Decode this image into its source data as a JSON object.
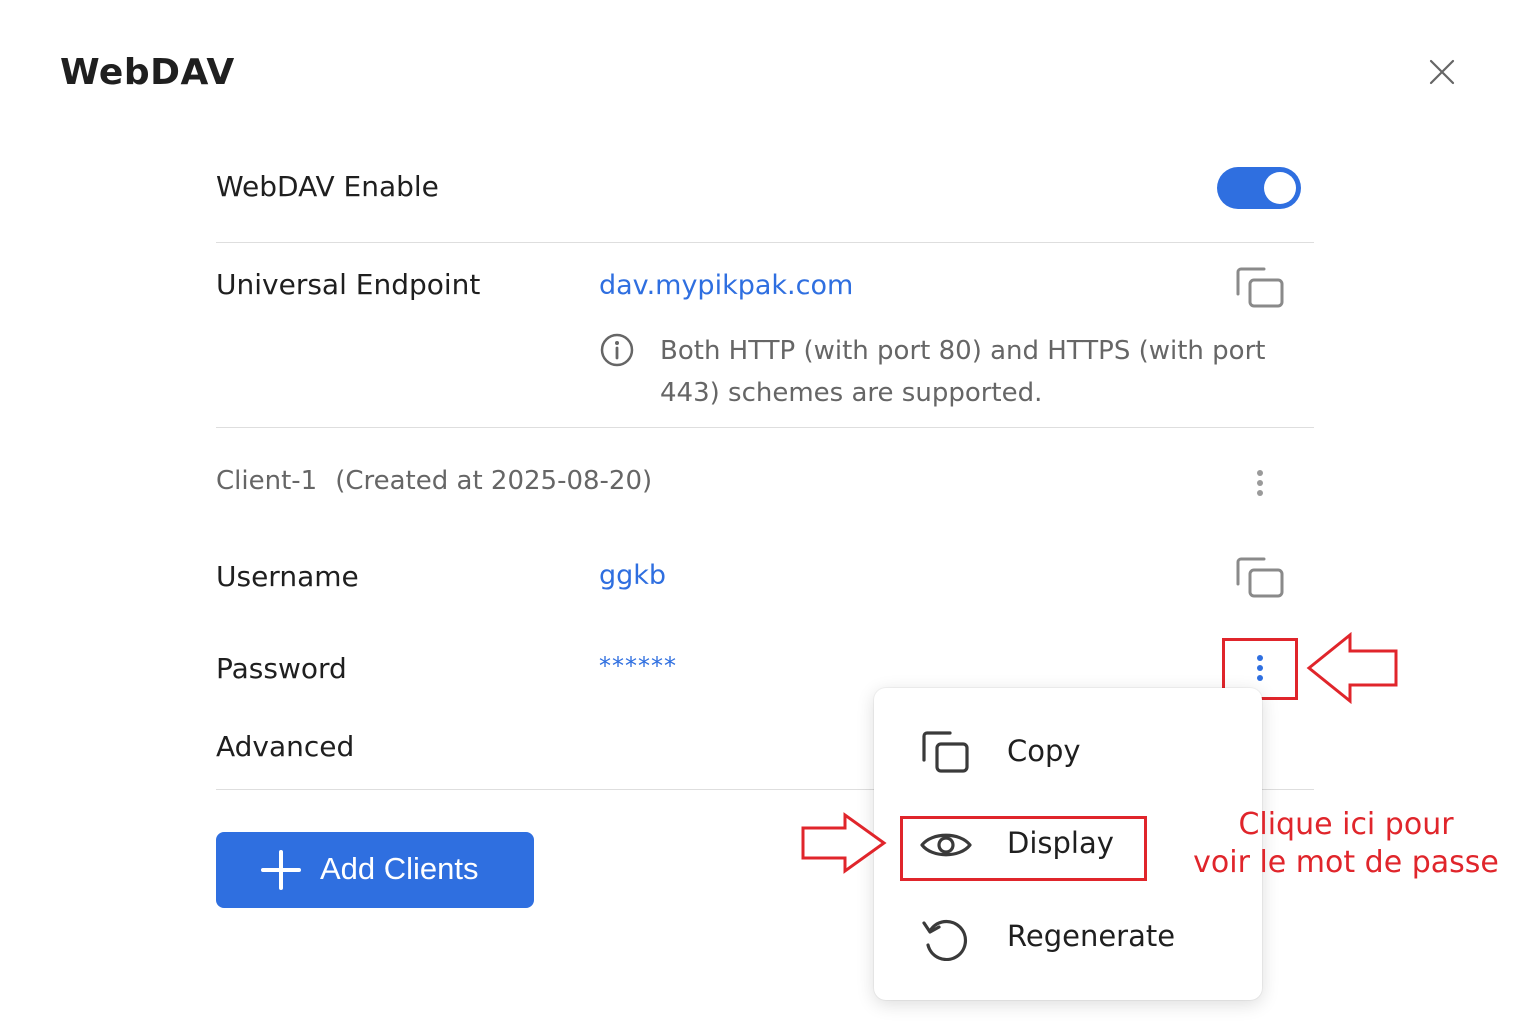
{
  "dialog": {
    "title": "WebDAV",
    "close_icon": "close-icon"
  },
  "enable": {
    "label": "WebDAV Enable",
    "enabled": true
  },
  "endpoint": {
    "label": "Universal Endpoint",
    "value": "dav.mypikpak.com",
    "info": "Both HTTP (with port 80) and HTTPS (with port 443) schemes are supported."
  },
  "client": {
    "name": "Client-1",
    "created": "(Created at 2025-08-20)",
    "username_label": "Username",
    "username_value": "ggkb",
    "password_label": "Password",
    "password_value": "******",
    "advanced_label": "Advanced"
  },
  "add_button": {
    "label": "Add Clients"
  },
  "menu": {
    "items": [
      {
        "label": "Copy",
        "icon": "copy-icon"
      },
      {
        "label": "Display",
        "icon": "eye-icon"
      },
      {
        "label": "Regenerate",
        "icon": "refresh-icon"
      }
    ]
  },
  "annotation": {
    "line1": "Clique ici pour",
    "line2": "voir le mot de passe"
  },
  "colors": {
    "accent": "#2f6fe0",
    "annotation": "#e0252b",
    "text": "#1f1f1f",
    "muted": "#666666"
  }
}
